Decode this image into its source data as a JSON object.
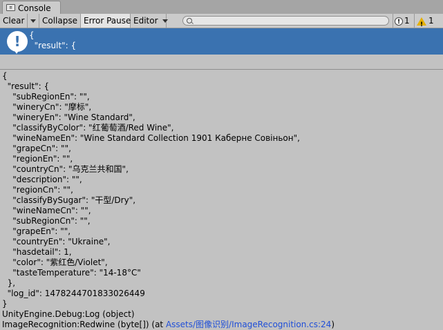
{
  "tab": {
    "label": "Console"
  },
  "toolbar": {
    "clear": "Clear",
    "collapse": "Collapse",
    "error_pause": "Error Pause",
    "editor": "Editor",
    "search_placeholder": "",
    "info_count": "1",
    "warning_count": "1"
  },
  "selected_entry": {
    "line1": "{",
    "line2": "  \"result\": {"
  },
  "detail_lines": [
    "{",
    "  \"result\": {",
    "    \"subRegionEn\": \"\",",
    "    \"wineryCn\": \"摩标\",",
    "    \"wineryEn\": \"Wine Standard\",",
    "    \"classifyByColor\": \"红葡萄酒/Red Wine\",",
    "    \"wineNameEn\": \"Wine Standard Collection 1901 Каберне Совіньон\",",
    "    \"grapeCn\": \"\",",
    "    \"regionEn\": \"\",",
    "    \"countryCn\": \"乌克兰共和国\",",
    "    \"description\": \"\",",
    "    \"regionCn\": \"\",",
    "    \"classifyBySugar\": \"干型/Dry\",",
    "    \"wineNameCn\": \"\",",
    "    \"subRegionCn\": \"\",",
    "    \"grapeEn\": \"\",",
    "    \"countryEn\": \"Ukraine\",",
    "    \"hasdetail\": 1,",
    "    \"color\": \"紫红色/Violet\",",
    "    \"tasteTemperature\": \"14-18°C\"",
    "  },",
    "  \"log_id\": 1478244701833026449",
    "}",
    "UnityEngine.Debug:Log (object)"
  ],
  "stack_last": {
    "prefix": "ImageRecognition:Redwine (byte[]) (at ",
    "link": "Assets/图像识别/ImageRecognition.cs:24",
    "suffix": ")"
  },
  "colors": {
    "selection": "#3a72b0",
    "link": "#1f4fd8",
    "warning": "#e5b000"
  }
}
